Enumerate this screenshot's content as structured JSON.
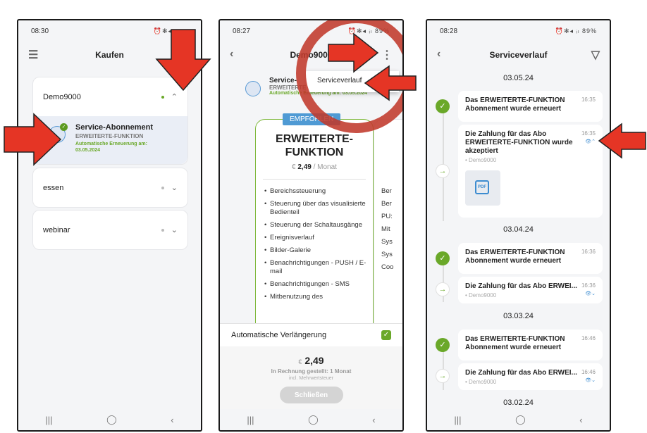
{
  "phone1": {
    "time": "08:30",
    "title": "Kaufen",
    "groups": [
      {
        "name": "Demo9000",
        "expanded": true
      },
      {
        "name": "essen",
        "expanded": false
      },
      {
        "name": "webinar",
        "expanded": false
      }
    ],
    "subscription": {
      "title": "Service-Abonnement",
      "level": "ERWEITERTE-FUNKTION",
      "renewal": "Automatische Erneuerung am: 03.05.2024"
    }
  },
  "phone2": {
    "time": "08:27",
    "battery": "89%",
    "title": "Demo9000",
    "menu_item": "Serviceverlauf",
    "mini": {
      "title": "Service-",
      "level": "ERWEITERTE-",
      "renewal": "Automatische Erneuerung am: 03.05.2024"
    },
    "badge": "EMPFOHLEN",
    "plan_title": "ERWEITERTE-FUNKTION",
    "price_currency": "€",
    "price_value": "2,49",
    "price_period": "/ Monat",
    "features": [
      "Bereichssteuerung",
      "Steuerung über das visualisierte Bedienteil",
      "Steuerung der Schaltausgänge",
      "Ereignisverlauf",
      "Bilder-Galerie",
      "Benachrichtigungen - PUSH / E-mail",
      "Benachrichtigungen - SMS",
      "Mitbenutzung des"
    ],
    "features_second": [
      "Ber",
      "Ber",
      "PU:",
      "Mit",
      "Sys",
      "Sys",
      "Coo"
    ],
    "auto_renew_label": "Automatische Verlängerung",
    "sheet_price": "2,49",
    "billing": "In Rechnung gestellt: 1 Monat",
    "tax": "incl. Mehrwertsteuer",
    "close_button": "Schließen"
  },
  "phone3": {
    "time": "08:28",
    "battery": "89%",
    "title": "Serviceverlauf",
    "sections": [
      {
        "date": "03.05.24",
        "renewal": {
          "text": "Das ERWEITERTE-FUNKTION Abonnement wurde erneuert",
          "time": "16:35"
        },
        "payment": {
          "text": "Die Zahlung für das Abo ERWEITERTE-FUNKTION wurde akzeptiert",
          "time": "16:35",
          "device": "• Demo9000"
        }
      },
      {
        "date": "03.04.24",
        "renewal": {
          "text": "Das ERWEITERTE-FUNKTION Abonnement wurde erneuert",
          "time": "16:36"
        },
        "payment": {
          "text": "Die Zahlung für das Abo ERWEI...",
          "time": "16:36",
          "device": "• Demo9000"
        }
      },
      {
        "date": "03.03.24",
        "renewal": {
          "text": "Das ERWEITERTE-FUNKTION Abonnement wurde erneuert",
          "time": "16:46"
        },
        "payment": {
          "text": "Die Zahlung für das Abo ERWEI...",
          "time": "16:46",
          "device": "• Demo9000"
        }
      },
      {
        "date": "03.02.24"
      }
    ],
    "pdf_label": "PDF"
  },
  "colors": {
    "green": "#6aa829",
    "blue": "#4f9ad4",
    "red_annotation": "#e53525"
  }
}
